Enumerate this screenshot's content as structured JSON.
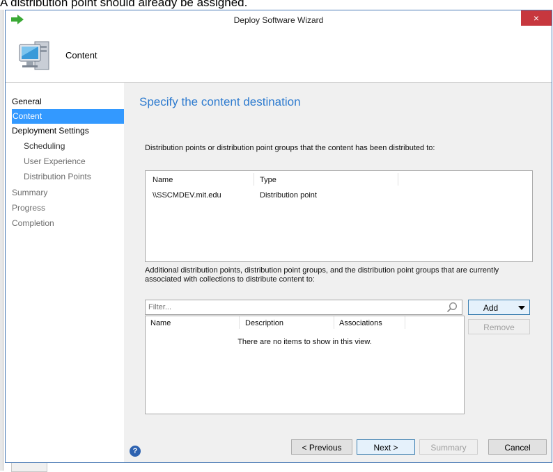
{
  "background": {
    "top_text": "A distribution point should already be assigned."
  },
  "window": {
    "title": "Deploy Software Wizard",
    "close_glyph": "×"
  },
  "header": {
    "title": "Content"
  },
  "nav": {
    "items": [
      {
        "label": "General"
      },
      {
        "label": "Content"
      },
      {
        "label": "Deployment Settings"
      },
      {
        "label": "Scheduling"
      },
      {
        "label": "User Experience"
      },
      {
        "label": "Distribution Points"
      },
      {
        "label": "Summary"
      },
      {
        "label": "Progress"
      },
      {
        "label": "Completion"
      }
    ]
  },
  "main": {
    "title": "Specify the content destination",
    "distributed_label": "Distribution points or distribution point groups that the content has been distributed to:",
    "distributed_table": {
      "columns": [
        "Name",
        "Type"
      ],
      "rows": [
        {
          "name": "\\\\SSCMDEV.mit.edu",
          "type": "Distribution point"
        }
      ]
    },
    "additional_label": "Additional distribution points, distribution point groups, and the distribution point groups that are currently associated with collections to distribute content to:",
    "filter_placeholder": "Filter...",
    "additional_table": {
      "columns": [
        "Name",
        "Description",
        "Associations"
      ],
      "empty_message": "There are no items to show in this view."
    },
    "add_label": "Add",
    "remove_label": "Remove"
  },
  "footer": {
    "help_glyph": "?",
    "previous_label": "< Previous",
    "next_label": "Next >",
    "summary_label": "Summary",
    "cancel_label": "Cancel"
  },
  "colors": {
    "accent": "#3399ff",
    "title_blue": "#2e7bcf",
    "close_red": "#c7373e"
  }
}
